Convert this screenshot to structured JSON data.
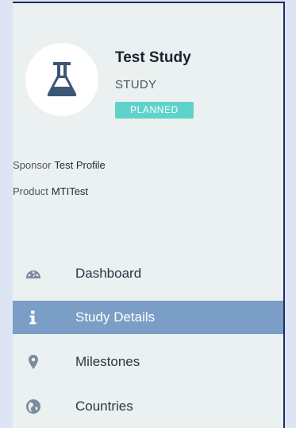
{
  "study": {
    "title": "Test Study",
    "type": "STUDY",
    "status": "PLANNED",
    "icon": "flask-icon"
  },
  "meta": {
    "sponsor_label": "Sponsor",
    "sponsor_value": "Test Profile",
    "product_label": "Product",
    "product_value": "MTITest"
  },
  "nav": {
    "items": [
      {
        "label": "Dashboard",
        "icon": "dashboard-icon",
        "active": false
      },
      {
        "label": "Study Details",
        "icon": "info-icon",
        "active": true
      },
      {
        "label": "Milestones",
        "icon": "map-marker-icon",
        "active": false
      },
      {
        "label": "Countries",
        "icon": "globe-icon",
        "active": false
      }
    ]
  },
  "colors": {
    "page_bg": "#dde5f4",
    "panel_bg": "#ebf0f0",
    "border": "#1f2b63",
    "badge": "#5fd3cb",
    "active_nav": "#7a9ec6",
    "icon_dark": "#3d5576"
  }
}
